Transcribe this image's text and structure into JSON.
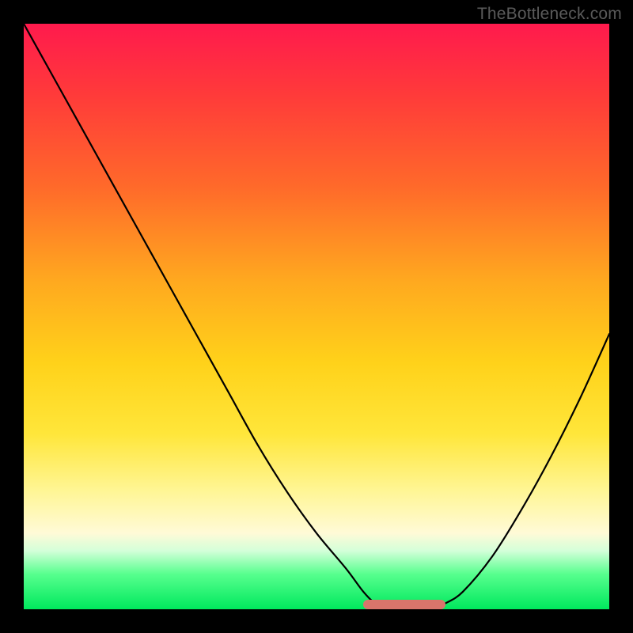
{
  "watermark": "TheBottleneck.com",
  "colors": {
    "frame": "#000000",
    "curve": "#000000",
    "optimal_bar": "#d9756b",
    "gradient_top": "#ff1a4d",
    "gradient_bottom": "#00e85d"
  },
  "chart_data": {
    "type": "line",
    "title": "",
    "xlabel": "",
    "ylabel": "",
    "xlim": [
      0,
      100
    ],
    "ylim": [
      0,
      100
    ],
    "series": [
      {
        "name": "bottleneck-curve",
        "x": [
          0,
          5,
          10,
          15,
          20,
          25,
          30,
          35,
          40,
          45,
          50,
          55,
          58,
          60,
          62,
          65,
          68,
          70,
          72,
          75,
          80,
          85,
          90,
          95,
          100
        ],
        "y": [
          100,
          91,
          82,
          73,
          64,
          55,
          46,
          37,
          28,
          20,
          13,
          7,
          3,
          1,
          0,
          0,
          0,
          0,
          1,
          3,
          9,
          17,
          26,
          36,
          47
        ]
      }
    ],
    "optimal_range": {
      "start": 58,
      "end": 72
    },
    "gradient_stops": [
      {
        "pct": 0,
        "color": "#ff1a4d"
      },
      {
        "pct": 12,
        "color": "#ff3a3a"
      },
      {
        "pct": 28,
        "color": "#ff6a2a"
      },
      {
        "pct": 44,
        "color": "#ffa91f"
      },
      {
        "pct": 58,
        "color": "#ffd21a"
      },
      {
        "pct": 70,
        "color": "#ffe63a"
      },
      {
        "pct": 80,
        "color": "#fff697"
      },
      {
        "pct": 87,
        "color": "#fffad7"
      },
      {
        "pct": 90,
        "color": "#d4ffd9"
      },
      {
        "pct": 94,
        "color": "#57ff8e"
      },
      {
        "pct": 100,
        "color": "#00e85d"
      }
    ]
  }
}
